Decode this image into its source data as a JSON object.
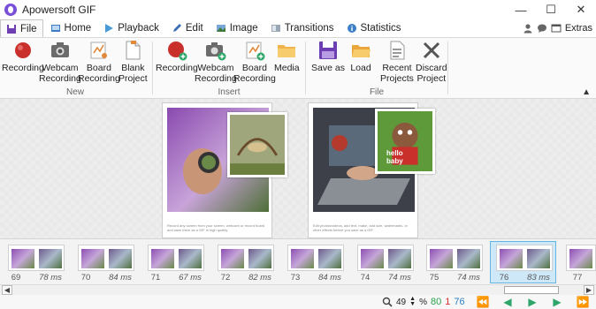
{
  "window": {
    "title": "Apowersoft GIF",
    "controls": [
      "—",
      "☐",
      "✕"
    ]
  },
  "menu": {
    "tabs": [
      {
        "label": "File",
        "icon": "save-icon",
        "active": true
      },
      {
        "label": "Home",
        "icon": "home-icon"
      },
      {
        "label": "Playback",
        "icon": "play-icon"
      },
      {
        "label": "Edit",
        "icon": "pencil-icon"
      },
      {
        "label": "Image",
        "icon": "image-icon"
      },
      {
        "label": "Transitions",
        "icon": "transitions-icon"
      },
      {
        "label": "Statistics",
        "icon": "info-icon"
      }
    ],
    "extras_label": "Extras"
  },
  "ribbon": {
    "groups": [
      {
        "title": "New",
        "buttons": [
          {
            "label": "Recording",
            "icon": "record-icon"
          },
          {
            "label": "Webcam\nRecording",
            "icon": "camera-icon"
          },
          {
            "label": "Board\nRecording",
            "icon": "board-icon"
          },
          {
            "label": "Blank\nProject",
            "icon": "blank-page-icon"
          }
        ]
      },
      {
        "title": "Insert",
        "buttons": [
          {
            "label": "Recording",
            "icon": "record-add-icon"
          },
          {
            "label": "Webcam\nRecording",
            "icon": "camera-add-icon"
          },
          {
            "label": "Board\nRecording",
            "icon": "board-add-icon"
          },
          {
            "label": "Media",
            "icon": "folder-icon"
          }
        ]
      },
      {
        "title": "File",
        "buttons": [
          {
            "label": "Save as",
            "icon": "save-icon"
          },
          {
            "label": "Load",
            "icon": "folder-open-icon"
          },
          {
            "label": "Recent\nProjects",
            "icon": "recent-icon"
          },
          {
            "label": "Discard\nProject",
            "icon": "discard-icon"
          }
        ]
      }
    ]
  },
  "preview": {
    "frame1_caption": "Record any screen from your screen, webcam or record board and save them as a GIF in high quality.",
    "frame2_caption": "Edit photos/videos, add text, make, add size, watermarks, or other effects before you save as a GIF.",
    "frame2_inset_text": "hello baby"
  },
  "filmstrip": [
    {
      "num": "69",
      "delay": "78 ms",
      "selected": false
    },
    {
      "num": "70",
      "delay": "84 ms",
      "selected": false
    },
    {
      "num": "71",
      "delay": "67 ms",
      "selected": false
    },
    {
      "num": "72",
      "delay": "82 ms",
      "selected": false
    },
    {
      "num": "73",
      "delay": "84 ms",
      "selected": false
    },
    {
      "num": "74",
      "delay": "74 ms",
      "selected": false
    },
    {
      "num": "75",
      "delay": "74 ms",
      "selected": false
    },
    {
      "num": "76",
      "delay": "83 ms",
      "selected": true
    },
    {
      "num": "77",
      "delay": "",
      "selected": false
    }
  ],
  "status": {
    "zoom": "49",
    "zoom_unit": "%",
    "total_frames": "80",
    "selected_count": "1",
    "current_frame": "76"
  },
  "colors": {
    "accent_blue": "#2a7fc6",
    "record_red": "#c9302c",
    "nav_green": "#2ea66a"
  }
}
